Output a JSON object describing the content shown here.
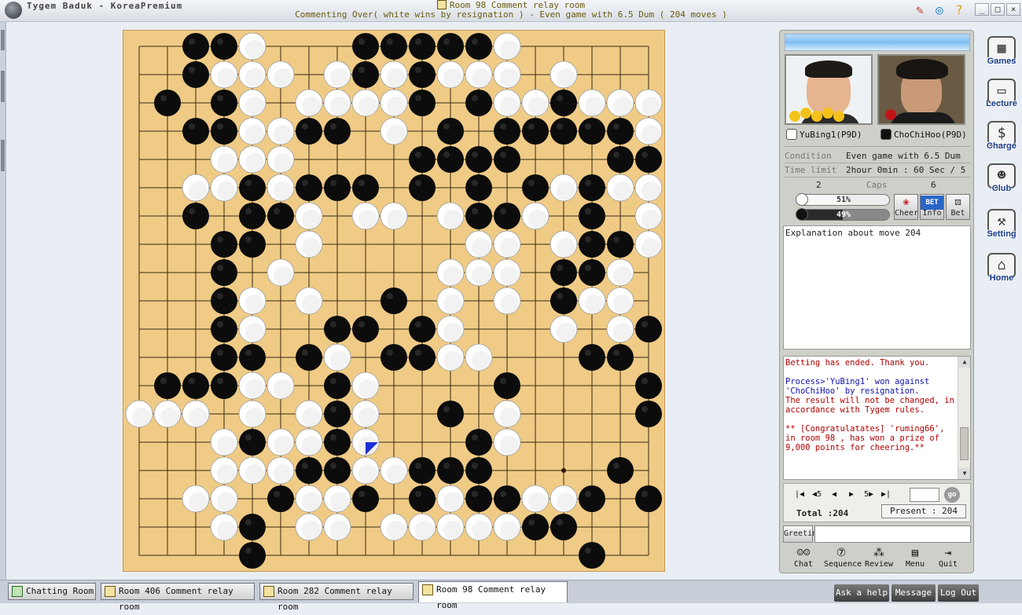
{
  "window": {
    "app_title": "Tygem Baduk - KoreaPremium",
    "room_title": "Room 98 Comment relay room",
    "status": "Commenting Over( white wins by resignation ) - Even game with 6.5 Dum  ( 204 moves )"
  },
  "players": {
    "white": {
      "name": "YuBing1(P9D)",
      "color": "white"
    },
    "black": {
      "name": "ChoChiHoo(P9D)",
      "color": "black"
    }
  },
  "game_info": {
    "condition_label": "Condition",
    "condition_value": "Even game with 6.5 Dum",
    "time_label": "Time limit",
    "time_value": "2hour 0min : 60 Sec / 5",
    "caps_label": "Caps",
    "caps_white": "2",
    "caps_black": "6"
  },
  "cheer": {
    "white_pct": "51%",
    "black_pct": "49%",
    "white_level": 0.51,
    "black_level": 0.49,
    "cheer_label": "Cheer",
    "info_label": "Info",
    "bet_label": "Bet",
    "bet_badge": "BET"
  },
  "explanation": "Explanation about move 204",
  "chat": {
    "line1": "Betting has ended. Thank you.",
    "line2a": "Process>'YuBing1' won against 'ChoChiHoo' by resignation.",
    "line2b": "The result will not be changed, in accordance with Tygem rules.",
    "line3": "** [Congratulatates] 'ruming66', in room 98 , has won a prize of 9,000 points for cheering.**"
  },
  "navigation": {
    "first": "|◀",
    "back5": "◀5",
    "back1": "◀",
    "fwd1": "▶",
    "fwd5": "5▶",
    "last": "▶|",
    "go": "go",
    "total": "Total :204",
    "present": "Present : 204"
  },
  "greeting": {
    "button": "Greeting",
    "value": ""
  },
  "bottom_buttons": [
    "Chat",
    "Sequence",
    "Review",
    "Menu",
    "Quit"
  ],
  "side_nav": [
    "Games",
    "Lecture",
    "Charge",
    "Club",
    "Setting",
    "Home"
  ],
  "tabs": [
    "Chatting Room",
    "Room 406 Comment relay room",
    "Room 282 Comment relay room",
    "Room 98 Comment relay room"
  ],
  "system_buttons": [
    "Ask a help",
    "Message",
    "Log Out"
  ],
  "board": {
    "size": 19,
    "rows": [
      "..BBW...BBBBBW.....",
      "..BWWW.WBWBWWW.W...",
      ".B.BW.WWWWB.BWWBWWW",
      "..BBWWBB.W.B.BBBBBW",
      "...WWW....BBBB...BB",
      "..WWBWBBB.B.B.BWBWWB",
      "..B.BBW.WW.WBBW.B.W",
      "...BB.W.....WW.WBBW",
      "...B.W.....WWW.BBW.",
      "...BW.W..B.W.W.BWW.",
      "...BW..BB.BW...W.WB",
      "...BB.BW.BBWW...BB.B",
      ".BBBWW.BW....B....B.",
      "WWW.W.WBW..B.W....B",
      "...WBWWBW...BW.....",
      "...WWWBBWWBBB....B.",
      "..WW.BWWB.BWBBWWB.B",
      "...WB.WW.WWWWWBB...",
      "....B...........B.."
    ],
    "last_move_label": "W204"
  }
}
